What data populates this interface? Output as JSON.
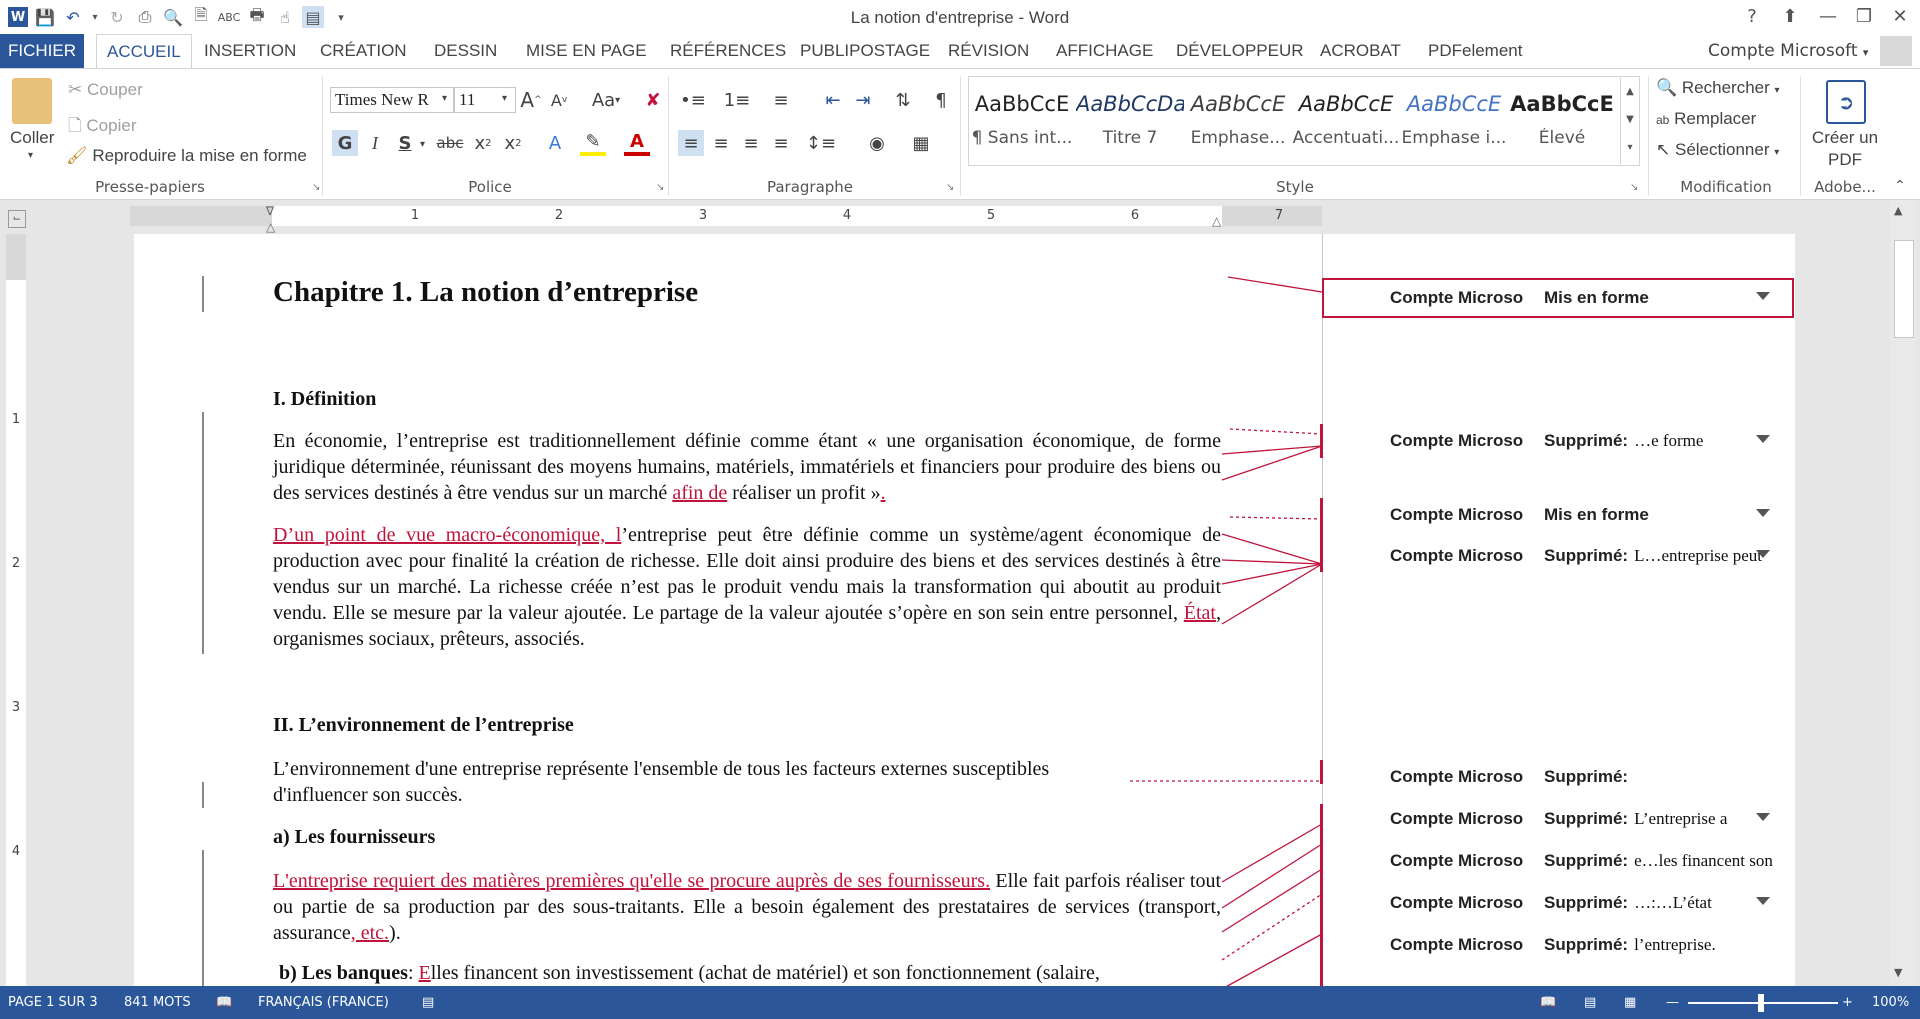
{
  "window": {
    "title": "La notion d'entreprise - Word"
  },
  "tabs": [
    {
      "label": "FICHIER"
    },
    {
      "label": "ACCUEIL"
    },
    {
      "label": "INSERTION"
    },
    {
      "label": "CRÉATION"
    },
    {
      "label": "DESSIN"
    },
    {
      "label": "MISE EN PAGE"
    },
    {
      "label": "RÉFÉRENCES"
    },
    {
      "label": "PUBLIPOSTAGE"
    },
    {
      "label": "RÉVISION"
    },
    {
      "label": "AFFICHAGE"
    },
    {
      "label": "DÉVELOPPEUR"
    },
    {
      "label": "ACROBAT"
    },
    {
      "label": "PDFelement"
    }
  ],
  "account": {
    "label": "Compte Microsoft"
  },
  "ribbon": {
    "clipboard": {
      "paste": "Coller",
      "cut": "Couper",
      "copy": "Copier",
      "format_painter": "Reproduire la mise en forme",
      "group": "Presse-papiers"
    },
    "font": {
      "name": "Times New R",
      "size": "11",
      "group": "Police",
      "bold": "G",
      "italic": "I",
      "underline": "S",
      "strike": "abc",
      "case": "Aa"
    },
    "paragraph": {
      "group": "Paragraphe"
    },
    "styles": {
      "group": "Style",
      "items": [
        {
          "sample": "AaBbCcE",
          "name": "¶ Sans int..."
        },
        {
          "sample": "AaBbCcDa",
          "name": "Titre 7"
        },
        {
          "sample": "AaBbCcE",
          "name": "Emphase..."
        },
        {
          "sample": "AaBbCcE",
          "name": "Accentuati..."
        },
        {
          "sample": "AaBbCcE",
          "name": "Emphase i..."
        },
        {
          "sample": "AaBbCcE",
          "name": "Élevé"
        }
      ]
    },
    "editing": {
      "find": "Rechercher",
      "replace": "Remplacer",
      "select": "Sélectionner",
      "group": "Modification"
    },
    "adobe": {
      "create": "Créer un PDF",
      "group": "Adobe..."
    }
  },
  "ruler": {
    "numbers": [
      "1",
      "2",
      "3",
      "4",
      "5",
      "6",
      "7"
    ]
  },
  "vruler": {
    "numbers": [
      "1",
      "2",
      "3",
      "4"
    ]
  },
  "document": {
    "title": "Chapitre 1. La notion d’entreprise",
    "h_def": "I. Définition",
    "p1_a": "En économie, l’entreprise est traditionnellement définie comme étant « une organisation économique, de forme juridique déterminée, réunissant des moyens humains, matériels, immatériels et financiers pour produire des biens ou des services destinés à être vendus sur un marché ",
    "p1_ins": "afin de",
    "p1_b": " réaliser un profit »",
    "p1_end": ".",
    "p2_ins": "D’un point de vue macro-économique, l",
    "p2_a": "’entreprise peut être définie comme un système/agent économique de production avec pour finalité la création de richesse. Elle doit ainsi produire des biens et des services destinés à être vendus sur un marché. La richesse créée n’est pas le produit vendu mais la transformation qui aboutit au produit vendu. Elle se mesure par la valeur ajoutée. Le partage de la valeur ajoutée s’opère en son sein entre personnel, ",
    "p2_ins2": "État",
    "p2_b": ", organismes sociaux, prêteurs, associés.",
    "h_env": "II. L’environnement de l’entreprise",
    "p3": "L’environnement d'une entreprise représente l'ensemble de tous les facteurs externes susceptibles d'influencer son succès.",
    "h_four": "a) Les fournisseurs",
    "p4_ins": "L'entreprise requiert des matières premières qu'elle se procure auprès de ses fournisseurs.",
    "p4_a": " Elle fait parfois réaliser tout ou partie de sa production par des sous-traitants. Elle a besoin également des prestataires de services (transport, assurance",
    "p4_ins2": ", etc.",
    "p4_b": ").",
    "h_banq": "b) Les banques",
    "p5_a": ": ",
    "p5_ins": "E",
    "p5_b": "lles financent son investissement (achat de matériel) et son fonctionnement (salaire,"
  },
  "balloons": [
    {
      "author": "Compte Microso",
      "type": "Mis en forme",
      "text": ""
    },
    {
      "author": "Compte Microso",
      "type": "Supprimé:",
      "text": "…e forme"
    },
    {
      "author": "Compte Microso",
      "type": "Mis en forme",
      "text": ""
    },
    {
      "author": "Compte Microso",
      "type": "Supprimé:",
      "text": "L…entreprise peut"
    },
    {
      "author": "Compte Microso",
      "type": "Supprimé:",
      "text": ""
    },
    {
      "author": "Compte Microso",
      "type": "Supprimé:",
      "text": "L’entreprise a"
    },
    {
      "author": "Compte Microso",
      "type": "Supprimé:",
      "text": "e…les financent son"
    },
    {
      "author": "Compte Microso",
      "type": "Supprimé:",
      "text": "…:…L’état"
    },
    {
      "author": "Compte Microso",
      "type": "Supprimé:",
      "text": "l’entreprise."
    }
  ],
  "status": {
    "page": "PAGE 1 SUR 3",
    "words": "841 MOTS",
    "language": "FRANÇAIS (FRANCE)",
    "zoom": "100%"
  },
  "colors": {
    "accent": "#2b579a",
    "revision": "#c0143c"
  }
}
